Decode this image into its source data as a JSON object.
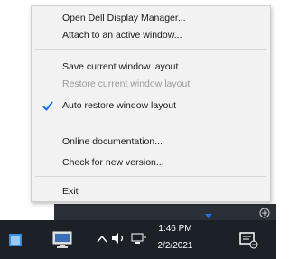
{
  "menu": {
    "items": [
      {
        "label": "Open Dell Display Manager...",
        "enabled": true,
        "checked": false
      },
      {
        "label": "Attach to an active window...",
        "enabled": true,
        "checked": false
      },
      {
        "label": "Save current window layout",
        "enabled": true,
        "checked": false
      },
      {
        "label": "Restore current window layout",
        "enabled": false,
        "checked": false
      },
      {
        "label": "Auto restore window layout",
        "enabled": true,
        "checked": true
      },
      {
        "label": "Online documentation...",
        "enabled": true,
        "checked": false
      },
      {
        "label": "Check for new version...",
        "enabled": true,
        "checked": false
      },
      {
        "label": "Exit",
        "enabled": true,
        "checked": false
      }
    ]
  },
  "taskbar": {
    "time": "1:46 PM",
    "date": "2/2/2021"
  },
  "colors": {
    "check_accent": "#1a73e8",
    "taskbar_bg": "#1c2128",
    "menu_bg": "#f2f2f2"
  }
}
